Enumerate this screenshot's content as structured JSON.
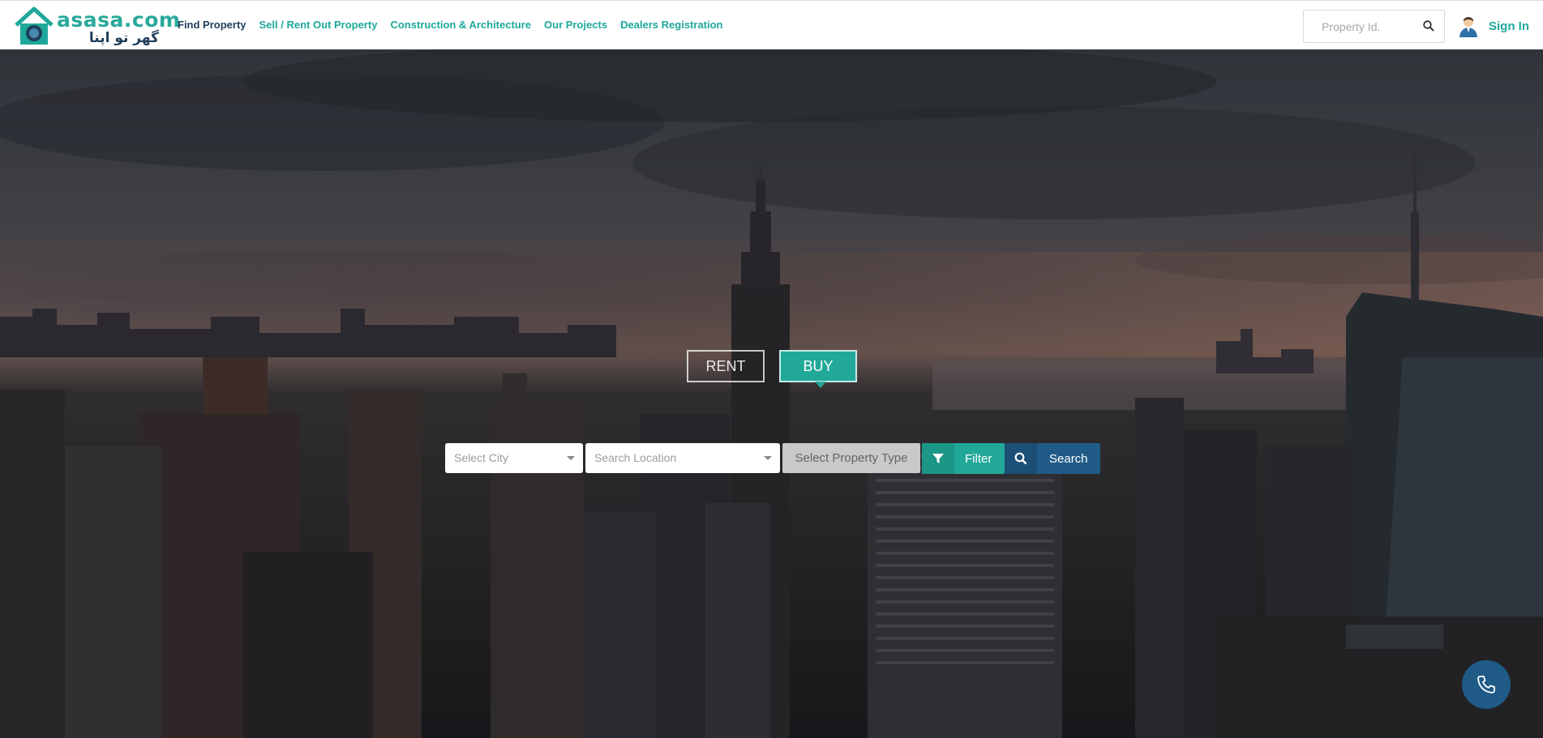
{
  "brand": {
    "name": "asasa.com",
    "tagline_urdu": "گھر تو اپنا ھی",
    "accent": "#22a898",
    "primary": "#1f5b86",
    "dark": "#1f3e5a"
  },
  "nav": {
    "items": [
      {
        "label": "Find Property",
        "style": "dark"
      },
      {
        "label": "Sell / Rent Out Property",
        "style": "teal"
      },
      {
        "label": "Construction & Architecture",
        "style": "teal"
      },
      {
        "label": "Our Projects",
        "style": "teal"
      },
      {
        "label": "Dealers Registration",
        "style": "teal"
      }
    ]
  },
  "header": {
    "property_search": {
      "placeholder": "Property Id.",
      "icon": "search-icon"
    },
    "signin": {
      "label": "Sign In",
      "icon": "user-avatar-icon"
    }
  },
  "hero": {
    "tabs": [
      {
        "label": "RENT",
        "active": false
      },
      {
        "label": "BUY",
        "active": true
      }
    ],
    "search": {
      "city_placeholder": "Select City",
      "location_placeholder": "Search Location",
      "property_type_placeholder": "Select Property Type",
      "filter_label": "Filter",
      "search_label": "Search"
    }
  },
  "fab": {
    "icon": "phone-icon"
  }
}
